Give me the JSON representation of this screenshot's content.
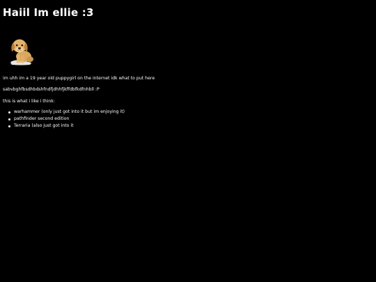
{
  "header": {
    "title": "Haiil Im ellie :3"
  },
  "image": {
    "icon": "puppy-photo"
  },
  "content": {
    "intro": "im uhh im a 19 year old puppygirl on the internet idk what to put here",
    "keysmash": "sabvbghfbsdhbdshfndfjdhhfjkffdbfkdfnhbll :P",
    "likes_heading": "this is what i like i think:",
    "likes": [
      "warhammer (only just got into it but im enjoying it)",
      "pathfinder second edition",
      "Terraria (also just got into it"
    ]
  },
  "colors": {
    "background": "#000000",
    "text": "#ffffff"
  }
}
